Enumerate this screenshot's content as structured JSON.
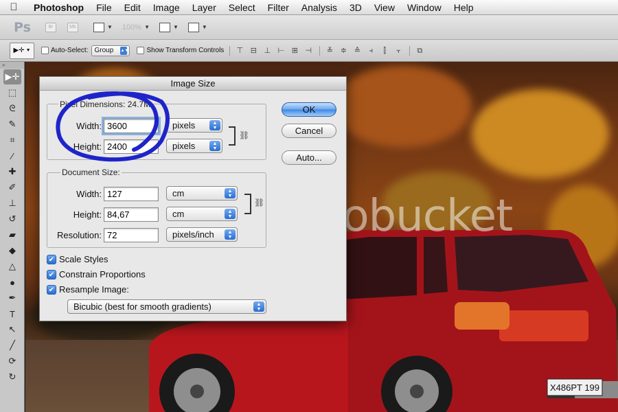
{
  "menubar": {
    "app_name": "Photoshop",
    "items": [
      "File",
      "Edit",
      "Image",
      "Layer",
      "Select",
      "Filter",
      "Analysis",
      "3D",
      "View",
      "Window",
      "Help"
    ]
  },
  "appbar": {
    "logo": "Ps",
    "bridge": "Br",
    "minibridge": "Mb",
    "zoom": "100%"
  },
  "options": {
    "auto_select_label": "Auto-Select:",
    "group_value": "Group",
    "show_transform_label": "Show Transform Controls"
  },
  "dialog": {
    "title": "Image Size",
    "pixel_dimensions": {
      "label": "Pixel Dimensions:",
      "size": "24.7M",
      "width_label": "Width:",
      "width_value": "3600",
      "width_unit": "pixels",
      "height_label": "Height:",
      "height_value": "2400",
      "height_unit": "pixels"
    },
    "document_size": {
      "label": "Document Size:",
      "width_label": "Width:",
      "width_value": "127",
      "width_unit": "cm",
      "height_label": "Height:",
      "height_value": "84,67",
      "height_unit": "cm",
      "resolution_label": "Resolution:",
      "resolution_value": "72",
      "resolution_unit": "pixels/inch"
    },
    "buttons": {
      "ok": "OK",
      "cancel": "Cancel",
      "auto": "Auto..."
    },
    "checkboxes": {
      "scale_styles": "Scale Styles",
      "constrain_proportions": "Constrain Proportions",
      "resample_image": "Resample Image:"
    },
    "resample_method": "Bicubic (best for smooth gradients)"
  },
  "canvas": {
    "watermark": "photobucket",
    "plate": "X486PT 199"
  },
  "colors": {
    "accent": "#3b87e4",
    "annotation": "#1f24c9"
  }
}
